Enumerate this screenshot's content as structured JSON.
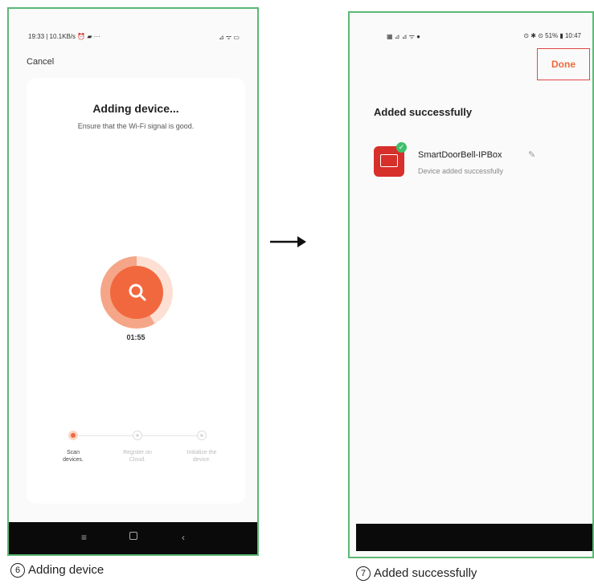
{
  "colors": {
    "frame": "#5cb874",
    "accent": "#f2683e",
    "done": "#ee6a3a",
    "done_border": "#e24848",
    "success": "#3fbf6a",
    "navbar": "#0a0a0a"
  },
  "screen1": {
    "status_left": "19:33 | 10.1KB/s ⏰ ▰ ···",
    "status_right": "⊿ ᯤ ▭",
    "cancel": "Cancel",
    "title": "Adding device...",
    "subtitle": "Ensure that the Wi-Fi signal is good.",
    "timer": "01:55",
    "steps": [
      {
        "line1": "Scan",
        "line2": "devices."
      },
      {
        "line1": "Register on",
        "line2": "Cloud."
      },
      {
        "line1": "Initialize the",
        "line2": "device."
      }
    ],
    "nav_icons": [
      "menu-icon",
      "home-icon",
      "back-icon"
    ],
    "nav_menu": "≡",
    "nav_back": "‹"
  },
  "screen2": {
    "status_left": "▦ ⊿ ⊿ ᯤ ●",
    "status_right": "⊙ ✱ ⊙ 51% ▮ 10:47",
    "done": "Done",
    "title": "Added successfully",
    "device_name": "SmartDoorBell-IPBox",
    "device_status": "Device added successfully",
    "edit": "✎"
  },
  "captions": [
    {
      "num": "6",
      "text": "Adding device"
    },
    {
      "num": "7",
      "text": "Added successfully"
    }
  ]
}
